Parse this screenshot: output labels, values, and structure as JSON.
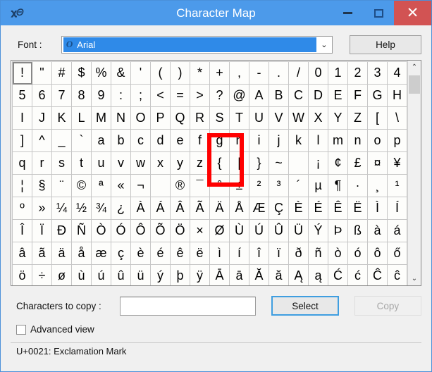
{
  "window": {
    "title": "Character Map",
    "app_icon": "character-map-icon",
    "buttons": {
      "minimize": "–",
      "maximize": "❐",
      "close": "✕"
    }
  },
  "font_row": {
    "label": "Font :",
    "selected_font": "Arial",
    "font_icon": "truetype-icon",
    "dropdown_arrow": "⌄",
    "help_label": "Help"
  },
  "grid": {
    "selected_cell": "!",
    "annotation": {
      "type": "red-rectangle",
      "target_char": "|",
      "color": "#ff0000"
    },
    "rows": [
      [
        "!",
        "\"",
        "#",
        "$",
        "%",
        "&",
        "'",
        "(",
        ")",
        "*",
        "+",
        ",",
        "-",
        ".",
        "/",
        "0",
        "1",
        "2",
        "3",
        "4"
      ],
      [
        "5",
        "6",
        "7",
        "8",
        "9",
        ":",
        ";",
        "<",
        "=",
        ">",
        "?",
        "@",
        "A",
        "B",
        "C",
        "D",
        "E",
        "F",
        "G",
        "H"
      ],
      [
        "I",
        "J",
        "K",
        "L",
        "M",
        "N",
        "O",
        "P",
        "Q",
        "R",
        "S",
        "T",
        "U",
        "V",
        "W",
        "X",
        "Y",
        "Z",
        "[",
        "\\"
      ],
      [
        "]",
        "^",
        "_",
        "`",
        "a",
        "b",
        "c",
        "d",
        "e",
        "f",
        "g",
        "h",
        "i",
        "j",
        "k",
        "l",
        "m",
        "n",
        "o",
        "p"
      ],
      [
        "q",
        "r",
        "s",
        "t",
        "u",
        "v",
        "w",
        "x",
        "y",
        "z",
        "{",
        "|",
        "}",
        "~",
        "",
        "¡",
        "¢",
        "£",
        "¤",
        "¥"
      ],
      [
        "¦",
        "§",
        "¨",
        "©",
        "ª",
        "«",
        "¬",
        "­",
        "®",
        "¯",
        "°",
        "±",
        "²",
        "³",
        "´",
        "µ",
        "¶",
        "·",
        "¸",
        "¹"
      ],
      [
        "º",
        "»",
        "¼",
        "½",
        "¾",
        "¿",
        "À",
        "Á",
        "Â",
        "Ã",
        "Ä",
        "Å",
        "Æ",
        "Ç",
        "È",
        "É",
        "Ê",
        "Ë",
        "Ì",
        "Í"
      ],
      [
        "Î",
        "Ï",
        "Ð",
        "Ñ",
        "Ò",
        "Ó",
        "Ô",
        "Õ",
        "Ö",
        "×",
        "Ø",
        "Ù",
        "Ú",
        "Û",
        "Ü",
        "Ý",
        "Þ",
        "ß",
        "à",
        "á"
      ],
      [
        "â",
        "ã",
        "ä",
        "å",
        "æ",
        "ç",
        "è",
        "é",
        "ê",
        "ë",
        "ì",
        "í",
        "î",
        "ï",
        "ð",
        "ñ",
        "ò",
        "ó",
        "ô",
        "ő"
      ],
      [
        "ö",
        "÷",
        "ø",
        "ù",
        "ú",
        "û",
        "ü",
        "ý",
        "þ",
        "ÿ",
        "Ā",
        "ā",
        "Ă",
        "ă",
        "Ą",
        "ą",
        "Ć",
        "ć",
        "Ĉ",
        "ĉ"
      ]
    ],
    "scrollbar": {
      "up_arrow": "⌃",
      "down_arrow": "⌄"
    }
  },
  "bottom": {
    "copy_label": "Characters to copy :",
    "copy_value": "",
    "copy_placeholder": "",
    "select_label": "Select",
    "copy_button_label": "Copy",
    "copy_button_disabled": true,
    "advanced_view_label": "Advanced view",
    "advanced_view_checked": false
  },
  "statusbar": {
    "text": "U+0021: Exclamation Mark"
  }
}
